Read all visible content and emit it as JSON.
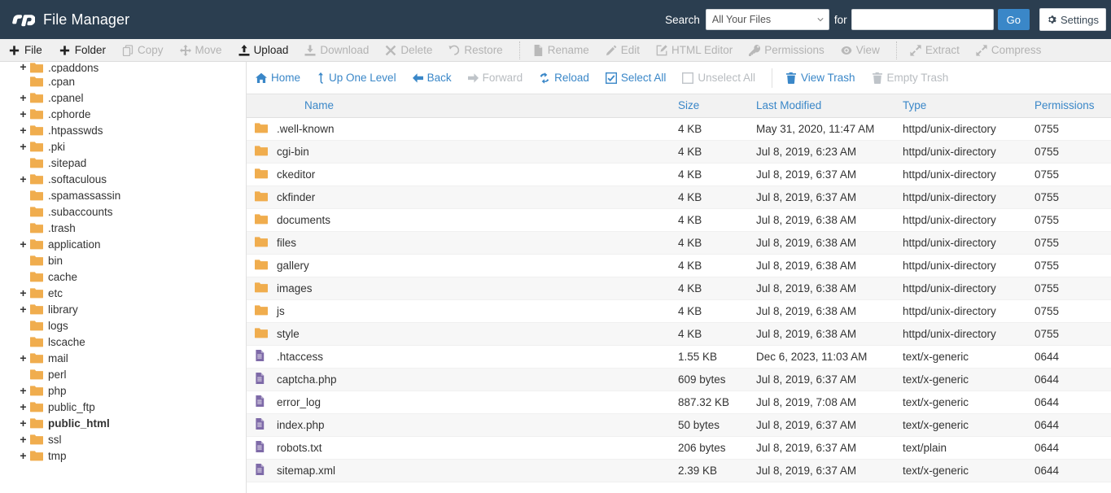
{
  "header": {
    "logo_icon": "cpanel-logo-icon",
    "title": "File Manager",
    "search_label": "Search",
    "search_scope_selected": "All Your Files",
    "search_scope_options": [
      "All Your Files"
    ],
    "for_label": "for",
    "search_value": "",
    "search_placeholder": "",
    "go_label": "Go",
    "settings_label": "Settings",
    "settings_icon": "gear-icon",
    "accent_blue": "#3a87c8",
    "header_bg": "#2b3e50"
  },
  "toolbar": {
    "items": [
      {
        "label": "File",
        "icon": "plus-icon",
        "enabled": true
      },
      {
        "label": "Folder",
        "icon": "plus-icon",
        "enabled": true
      },
      {
        "label": "Copy",
        "icon": "copy-icon",
        "enabled": false
      },
      {
        "label": "Move",
        "icon": "move-arrows-icon",
        "enabled": false
      },
      {
        "label": "Upload",
        "icon": "upload-icon",
        "enabled": true
      },
      {
        "label": "Download",
        "icon": "download-icon",
        "enabled": false
      },
      {
        "label": "Delete",
        "icon": "x-icon",
        "enabled": false
      },
      {
        "label": "Restore",
        "icon": "undo-icon",
        "enabled": false
      },
      {
        "separator": true
      },
      {
        "label": "Rename",
        "icon": "file-icon",
        "enabled": false
      },
      {
        "label": "Edit",
        "icon": "pencil-icon",
        "enabled": false
      },
      {
        "label": "HTML Editor",
        "icon": "edit-square-icon",
        "enabled": false
      },
      {
        "label": "Permissions",
        "icon": "key-icon",
        "enabled": false
      },
      {
        "label": "View",
        "icon": "eye-icon",
        "enabled": false
      },
      {
        "separator": true
      },
      {
        "label": "Extract",
        "icon": "extract-icon",
        "enabled": false
      },
      {
        "label": "Compress",
        "icon": "compress-icon",
        "enabled": false
      }
    ]
  },
  "sidebar": {
    "tree": [
      {
        "label": ".cpaddons",
        "expandable": true,
        "selected": false,
        "clipped": true
      },
      {
        "label": ".cpan",
        "expandable": false,
        "selected": false
      },
      {
        "label": ".cpanel",
        "expandable": true,
        "selected": false
      },
      {
        "label": ".cphorde",
        "expandable": true,
        "selected": false
      },
      {
        "label": ".htpasswds",
        "expandable": true,
        "selected": false
      },
      {
        "label": ".pki",
        "expandable": true,
        "selected": false
      },
      {
        "label": ".sitepad",
        "expandable": false,
        "selected": false
      },
      {
        "label": ".softaculous",
        "expandable": true,
        "selected": false
      },
      {
        "label": ".spamassassin",
        "expandable": false,
        "selected": false
      },
      {
        "label": ".subaccounts",
        "expandable": false,
        "selected": false
      },
      {
        "label": ".trash",
        "expandable": false,
        "selected": false
      },
      {
        "label": "application",
        "expandable": true,
        "selected": false
      },
      {
        "label": "bin",
        "expandable": false,
        "selected": false
      },
      {
        "label": "cache",
        "expandable": false,
        "selected": false
      },
      {
        "label": "etc",
        "expandable": true,
        "selected": false
      },
      {
        "label": "library",
        "expandable": true,
        "selected": false
      },
      {
        "label": "logs",
        "expandable": false,
        "selected": false
      },
      {
        "label": "lscache",
        "expandable": false,
        "selected": false
      },
      {
        "label": "mail",
        "expandable": true,
        "selected": false
      },
      {
        "label": "perl",
        "expandable": false,
        "selected": false
      },
      {
        "label": "php",
        "expandable": true,
        "selected": false
      },
      {
        "label": "public_ftp",
        "expandable": true,
        "selected": false
      },
      {
        "label": "public_html",
        "expandable": true,
        "selected": true
      },
      {
        "label": "ssl",
        "expandable": true,
        "selected": false
      },
      {
        "label": "tmp",
        "expandable": true,
        "selected": false
      }
    ]
  },
  "navbar": {
    "items": [
      {
        "label": "Home",
        "icon": "home-icon",
        "enabled": true
      },
      {
        "label": "Up One Level",
        "icon": "up-arrow-icon",
        "enabled": true
      },
      {
        "label": "Back",
        "icon": "left-arrow-icon",
        "enabled": true
      },
      {
        "label": "Forward",
        "icon": "right-arrow-icon",
        "enabled": false
      },
      {
        "label": "Reload",
        "icon": "reload-icon",
        "enabled": true
      },
      {
        "label": "Select All",
        "icon": "checked-box-icon",
        "enabled": true
      },
      {
        "label": "Unselect All",
        "icon": "unchecked-box-icon",
        "enabled": false
      },
      {
        "separator": true
      },
      {
        "label": "View Trash",
        "icon": "trash-icon",
        "enabled": true
      },
      {
        "label": "Empty Trash",
        "icon": "trash-icon",
        "enabled": false
      }
    ]
  },
  "table": {
    "columns": [
      "Name",
      "Size",
      "Last Modified",
      "Type",
      "Permissions"
    ],
    "rows": [
      {
        "icon": "folder-icon",
        "name": ".well-known",
        "size": "4 KB",
        "modified": "May 31, 2020, 11:47 AM",
        "type": "httpd/unix-directory",
        "permissions": "0755"
      },
      {
        "icon": "folder-icon",
        "name": "cgi-bin",
        "size": "4 KB",
        "modified": "Jul 8, 2019, 6:23 AM",
        "type": "httpd/unix-directory",
        "permissions": "0755"
      },
      {
        "icon": "folder-icon",
        "name": "ckeditor",
        "size": "4 KB",
        "modified": "Jul 8, 2019, 6:37 AM",
        "type": "httpd/unix-directory",
        "permissions": "0755"
      },
      {
        "icon": "folder-icon",
        "name": "ckfinder",
        "size": "4 KB",
        "modified": "Jul 8, 2019, 6:37 AM",
        "type": "httpd/unix-directory",
        "permissions": "0755"
      },
      {
        "icon": "folder-icon",
        "name": "documents",
        "size": "4 KB",
        "modified": "Jul 8, 2019, 6:38 AM",
        "type": "httpd/unix-directory",
        "permissions": "0755"
      },
      {
        "icon": "folder-icon",
        "name": "files",
        "size": "4 KB",
        "modified": "Jul 8, 2019, 6:38 AM",
        "type": "httpd/unix-directory",
        "permissions": "0755"
      },
      {
        "icon": "folder-icon",
        "name": "gallery",
        "size": "4 KB",
        "modified": "Jul 8, 2019, 6:38 AM",
        "type": "httpd/unix-directory",
        "permissions": "0755"
      },
      {
        "icon": "folder-icon",
        "name": "images",
        "size": "4 KB",
        "modified": "Jul 8, 2019, 6:38 AM",
        "type": "httpd/unix-directory",
        "permissions": "0755"
      },
      {
        "icon": "folder-icon",
        "name": "js",
        "size": "4 KB",
        "modified": "Jul 8, 2019, 6:38 AM",
        "type": "httpd/unix-directory",
        "permissions": "0755"
      },
      {
        "icon": "folder-icon",
        "name": "style",
        "size": "4 KB",
        "modified": "Jul 8, 2019, 6:38 AM",
        "type": "httpd/unix-directory",
        "permissions": "0755"
      },
      {
        "icon": "file-icon",
        "name": ".htaccess",
        "size": "1.55 KB",
        "modified": "Dec 6, 2023, 11:03 AM",
        "type": "text/x-generic",
        "permissions": "0644"
      },
      {
        "icon": "file-icon",
        "name": "captcha.php",
        "size": "609 bytes",
        "modified": "Jul 8, 2019, 6:37 AM",
        "type": "text/x-generic",
        "permissions": "0644"
      },
      {
        "icon": "file-icon",
        "name": "error_log",
        "size": "887.32 KB",
        "modified": "Jul 8, 2019, 7:08 AM",
        "type": "text/x-generic",
        "permissions": "0644"
      },
      {
        "icon": "file-icon",
        "name": "index.php",
        "size": "50 bytes",
        "modified": "Jul 8, 2019, 6:37 AM",
        "type": "text/x-generic",
        "permissions": "0644"
      },
      {
        "icon": "file-icon",
        "name": "robots.txt",
        "size": "206 bytes",
        "modified": "Jul 8, 2019, 6:37 AM",
        "type": "text/plain",
        "permissions": "0644"
      },
      {
        "icon": "file-icon",
        "name": "sitemap.xml",
        "size": "2.39 KB",
        "modified": "Jul 8, 2019, 6:37 AM",
        "type": "text/x-generic",
        "permissions": "0644"
      }
    ]
  },
  "colors": {
    "folder_amber": "#f0ad4e",
    "file_purple": "#7e6aa8",
    "link_blue": "#3a87c8",
    "row_stripe": "#f7f7f7"
  }
}
